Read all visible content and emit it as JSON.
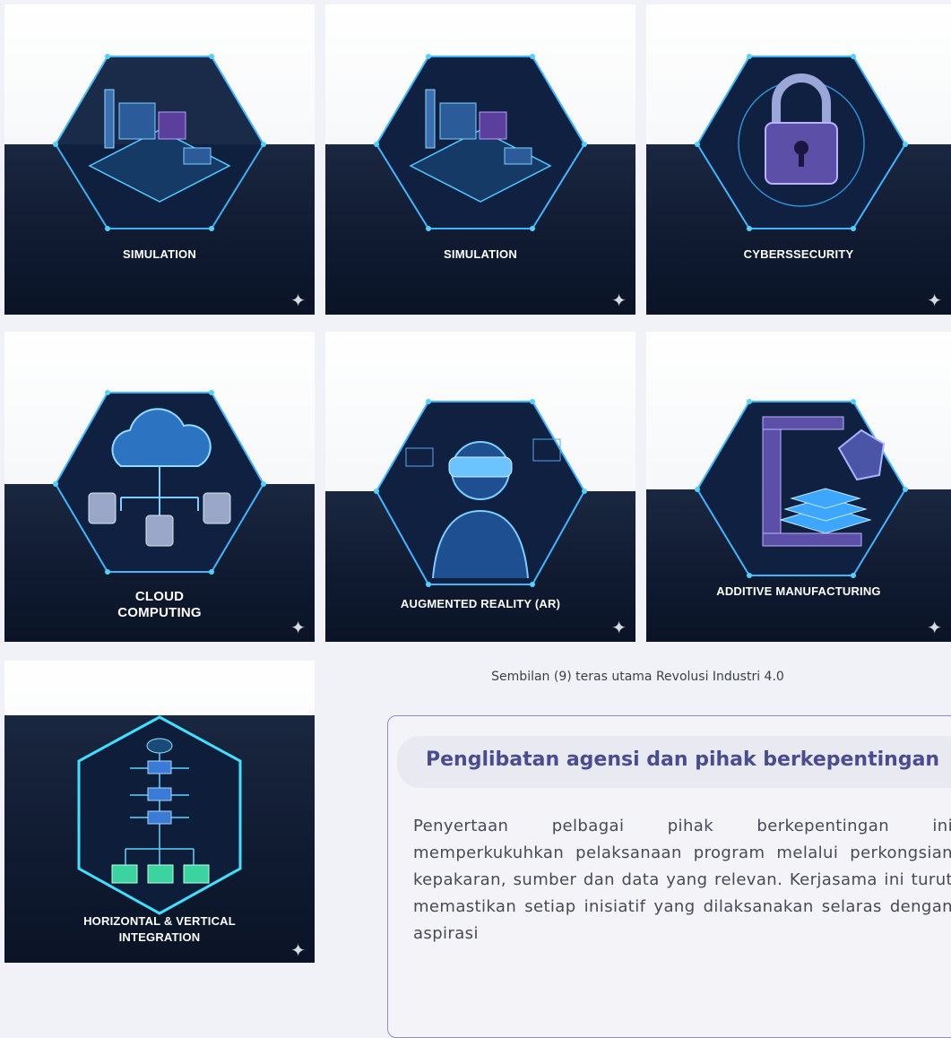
{
  "tiles": [
    {
      "label": "SIMULATION",
      "icon": "factory-icon"
    },
    {
      "label": "SIMULATION",
      "icon": "factory-icon"
    },
    {
      "label": "CYBERSSECURITY",
      "icon": "padlock-icon"
    },
    {
      "label_line1": "CLOUD",
      "label_line2": "COMPUTING",
      "icon": "cloud-icon"
    },
    {
      "label": "AUGMENTED REALITY (AR)",
      "icon": "vr-headset-person-icon"
    },
    {
      "label": "ADDITIVE MANUFACTURING",
      "icon": "3d-printer-icon"
    },
    {
      "label_line1": "HORIZONTAL & VERTICAL",
      "label_line2": "INTEGRATION",
      "icon": "network-diagram-icon"
    }
  ],
  "sparkle": "✦",
  "caption": "Sembilan (9) teras utama Revolusi Industri 4.0",
  "section": {
    "heading": "Penglibatan agensi dan pihak berkepentingan",
    "body": "Penyertaan pelbagai pihak berkepentingan ini memperkukuhkan pelaksanaan program melalui perkongsian kepakaran, sumber dan data yang relevan. Kerjasama ini turut memastikan setiap inisiatif yang dilaksanakan selaras dengan aspirasi"
  },
  "colors": {
    "accent": "#4a4c92",
    "glow": "#3fb6ff",
    "navy": "#0f1a30"
  }
}
